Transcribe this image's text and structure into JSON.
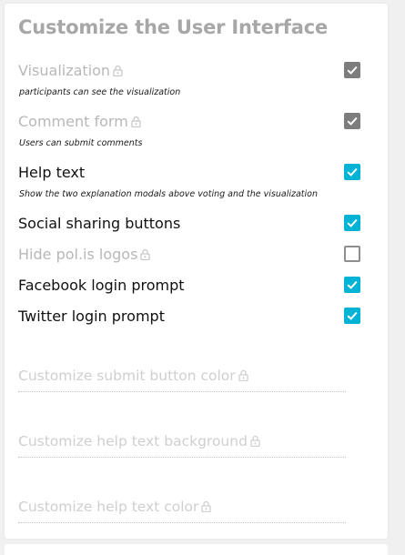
{
  "title": "Customize the User Interface",
  "colors": {
    "accent": "#03b3d6",
    "disabled_check": "#7d7d7d",
    "disabled_text": "#b8b8b8"
  },
  "options": [
    {
      "label": "Visualization",
      "checked": true,
      "locked": true,
      "description": "participants can see the visualization"
    },
    {
      "label": "Comment form",
      "checked": true,
      "locked": true,
      "description": "Users can submit comments"
    },
    {
      "label": "Help text",
      "checked": true,
      "locked": false,
      "description": "Show the two explanation modals above voting and the visualization"
    },
    {
      "label": "Social sharing buttons",
      "checked": true,
      "locked": false
    },
    {
      "label": "Hide pol.is logos",
      "checked": false,
      "locked": true
    },
    {
      "label": "Facebook login prompt",
      "checked": true,
      "locked": false
    },
    {
      "label": "Twitter login prompt",
      "checked": true,
      "locked": false
    }
  ],
  "fields": [
    {
      "placeholder": "Customize submit button color",
      "locked": true
    },
    {
      "placeholder": "Customize help text background",
      "locked": true
    },
    {
      "placeholder": "Customize help text color",
      "locked": true
    }
  ],
  "icons": {
    "lock": "lock-icon",
    "check": "checkmark-icon"
  }
}
